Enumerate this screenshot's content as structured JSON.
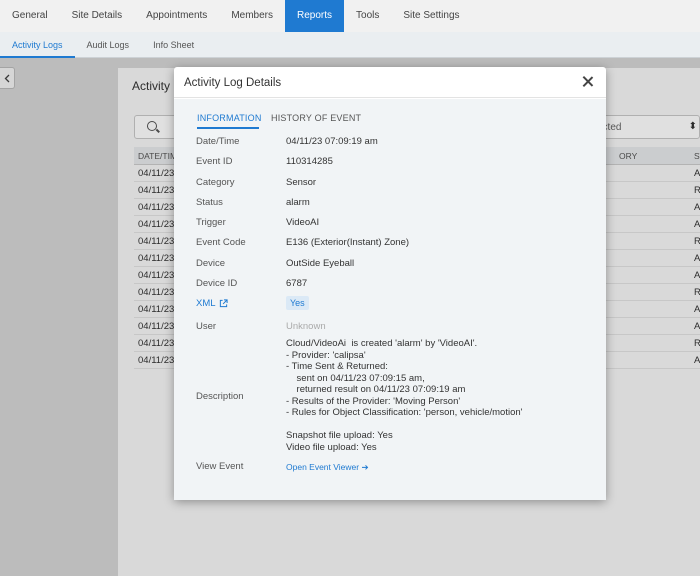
{
  "nav": {
    "tabs": [
      "General",
      "Site Details",
      "Appointments",
      "Members",
      "Reports",
      "Tools",
      "Site Settings"
    ],
    "active_index": 4
  },
  "subnav": {
    "tabs": [
      "Activity Logs",
      "Audit Logs",
      "Info Sheet"
    ],
    "active_index": 0
  },
  "background_panel": {
    "title": "Activity L",
    "select_value": "ected",
    "columns": [
      "DATE/TIM",
      "ORY",
      "ST"
    ],
    "rows": [
      {
        "date": "04/11/23",
        "status": "A"
      },
      {
        "date": "04/11/23",
        "status": "R"
      },
      {
        "date": "04/11/23",
        "status": "A"
      },
      {
        "date": "04/11/23",
        "status": "A"
      },
      {
        "date": "04/11/23",
        "status": "R"
      },
      {
        "date": "04/11/23",
        "status": "A"
      },
      {
        "date": "04/11/23",
        "status": "A"
      },
      {
        "date": "04/11/23",
        "status": "R"
      },
      {
        "date": "04/11/23",
        "status": "A"
      },
      {
        "date": "04/11/23",
        "status": "A"
      },
      {
        "date": "04/11/23",
        "status": "R"
      },
      {
        "date": "04/11/23",
        "status": "A"
      }
    ]
  },
  "modal": {
    "title": "Activity Log Details",
    "tabs": [
      "INFORMATION",
      "HISTORY OF EVENT"
    ],
    "fields": {
      "datetime": {
        "label": "Date/Time",
        "value": "04/11/23 07:09:19 am"
      },
      "event_id": {
        "label": "Event ID",
        "value": "110314285"
      },
      "category": {
        "label": "Category",
        "value": "Sensor"
      },
      "status": {
        "label": "Status",
        "value": "alarm"
      },
      "trigger": {
        "label": "Trigger",
        "value": "VideoAI"
      },
      "event_code": {
        "label": "Event Code",
        "value": "E136 (Exterior(Instant) Zone)"
      },
      "device": {
        "label": "Device",
        "value": "OutSide Eyeball"
      },
      "device_id": {
        "label": "Device ID",
        "value": "6787"
      },
      "xml": {
        "label": "XML",
        "value": "Yes"
      },
      "user": {
        "label": "User",
        "value": "Unknown"
      },
      "description": {
        "label": "Description",
        "value": "Cloud/VideoAi  is created 'alarm' by 'VideoAI'.\n- Provider: 'calipsa'\n- Time Sent & Returned:\n    sent on 04/11/23 07:09:15 am,\n    returned result on 04/11/23 07:09:19 am\n- Results of the Provider: 'Moving Person'\n- Rules for Object Classification: 'person, vehicle/motion'\n\nSnapshot file upload: Yes\nVideo file upload: Yes"
      },
      "view_event": {
        "label": "View Event",
        "value": "Open Event Viewer"
      }
    }
  },
  "colors": {
    "accent": "#1f7ad1",
    "badge_bg": "#dbe9f6",
    "muted": "#aaaaaa"
  }
}
